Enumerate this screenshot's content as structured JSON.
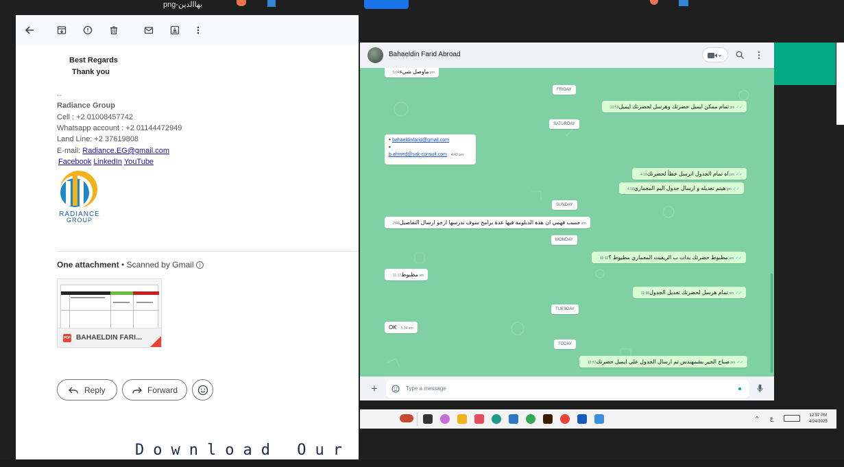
{
  "top_bar": {
    "file_label": "png-بهاالدين"
  },
  "gmail": {
    "toolbar": {
      "back": "back-arrow-icon",
      "archive": "archive-icon",
      "report": "report-spam-icon",
      "delete": "trash-icon",
      "mark_unread": "mark-unread-icon",
      "move": "move-to-icon",
      "more": "more-vert-icon"
    },
    "closing": {
      "line1": "Best Regards",
      "line2": "Thank you"
    },
    "signature": {
      "dashes": "--",
      "company": "Radiance Group",
      "cell": "Cell : +2 01008457742",
      "whatsapp": "Whatsapp account : +2 01144472949",
      "landline": "Land Line: +2 37619808",
      "email_label": "E-mail: ",
      "email": "Radiance.EG@gmail.com",
      "facebook": "Facebook",
      "linkedin": "LinkedIn",
      "youtube": "YouTube "
    },
    "logo": {
      "line1": "RADIANCE",
      "line2": "GROUP"
    },
    "attachments": {
      "title": "One attachment",
      "scanned": "• Scanned by Gmail",
      "file_name": "BAHAELDIN FARI...",
      "file_type": "PDF"
    },
    "actions": {
      "reply": "Reply",
      "forward": "Forward"
    },
    "watermark": "Download Our"
  },
  "whatsapp": {
    "contact_name": "Bahaeldin Farid Abroad",
    "input_placeholder": "Type a message",
    "accent": "#00a884",
    "chat_bg": "#7fd1a4",
    "days": {
      "friday": "FRIDAY",
      "saturday": "SATURDAY",
      "sunday": "SUNDAY",
      "monday": "MONDAY",
      "tuesday": "TUESDAY",
      "today": "TODAY"
    },
    "messages": {
      "m0": {
        "text": "ماوصل شيء",
        "time": "5:04 pm"
      },
      "m1": {
        "text": "تمام ممكن ايميل حضرتك وهرسل لحضرتك ايميل",
        "time": "10:58 pm"
      },
      "m2": {
        "email1": "bahaeldinfarid@gmail.com",
        "email2": "b.ahmed@sak-consult.com",
        "time": "4:43 am"
      },
      "m3": {
        "text": "اه تمام الجدول اترسل خطأ لحضرتك",
        "time": "4:10 pm"
      },
      "m4": {
        "text": "هيتم تعديله و ارسال جدول اليم المعماري",
        "time": "4:10 pm"
      },
      "m5": {
        "text": "حسب فهمي ان هذة الدبلومة فيها عدة برامج سوف ندرسها ارجو ارسال التفاصيل",
        "time": "2:46 am"
      },
      "m6": {
        "text": "مظبوط حضرتك بدات ب الريفيت المعماري مظبوط ؟",
        "time": "10:12 am"
      },
      "m7": {
        "text": "مظبوط",
        "time": "11:17 am"
      },
      "m8": {
        "text": "تمام هرسل لحضرتك تعديل الجدول",
        "time": "11:46 am"
      },
      "m9": {
        "text": "OK",
        "time": "5:34 am"
      },
      "m10": {
        "text": "صباح الخير بشمهندس تم ارسال الجدول علي ايميل حضرتك",
        "time": "12:57 pm"
      }
    }
  },
  "taskbar": {
    "time": "12:57 PM",
    "date": "4/24/2025",
    "lang": "ع"
  }
}
